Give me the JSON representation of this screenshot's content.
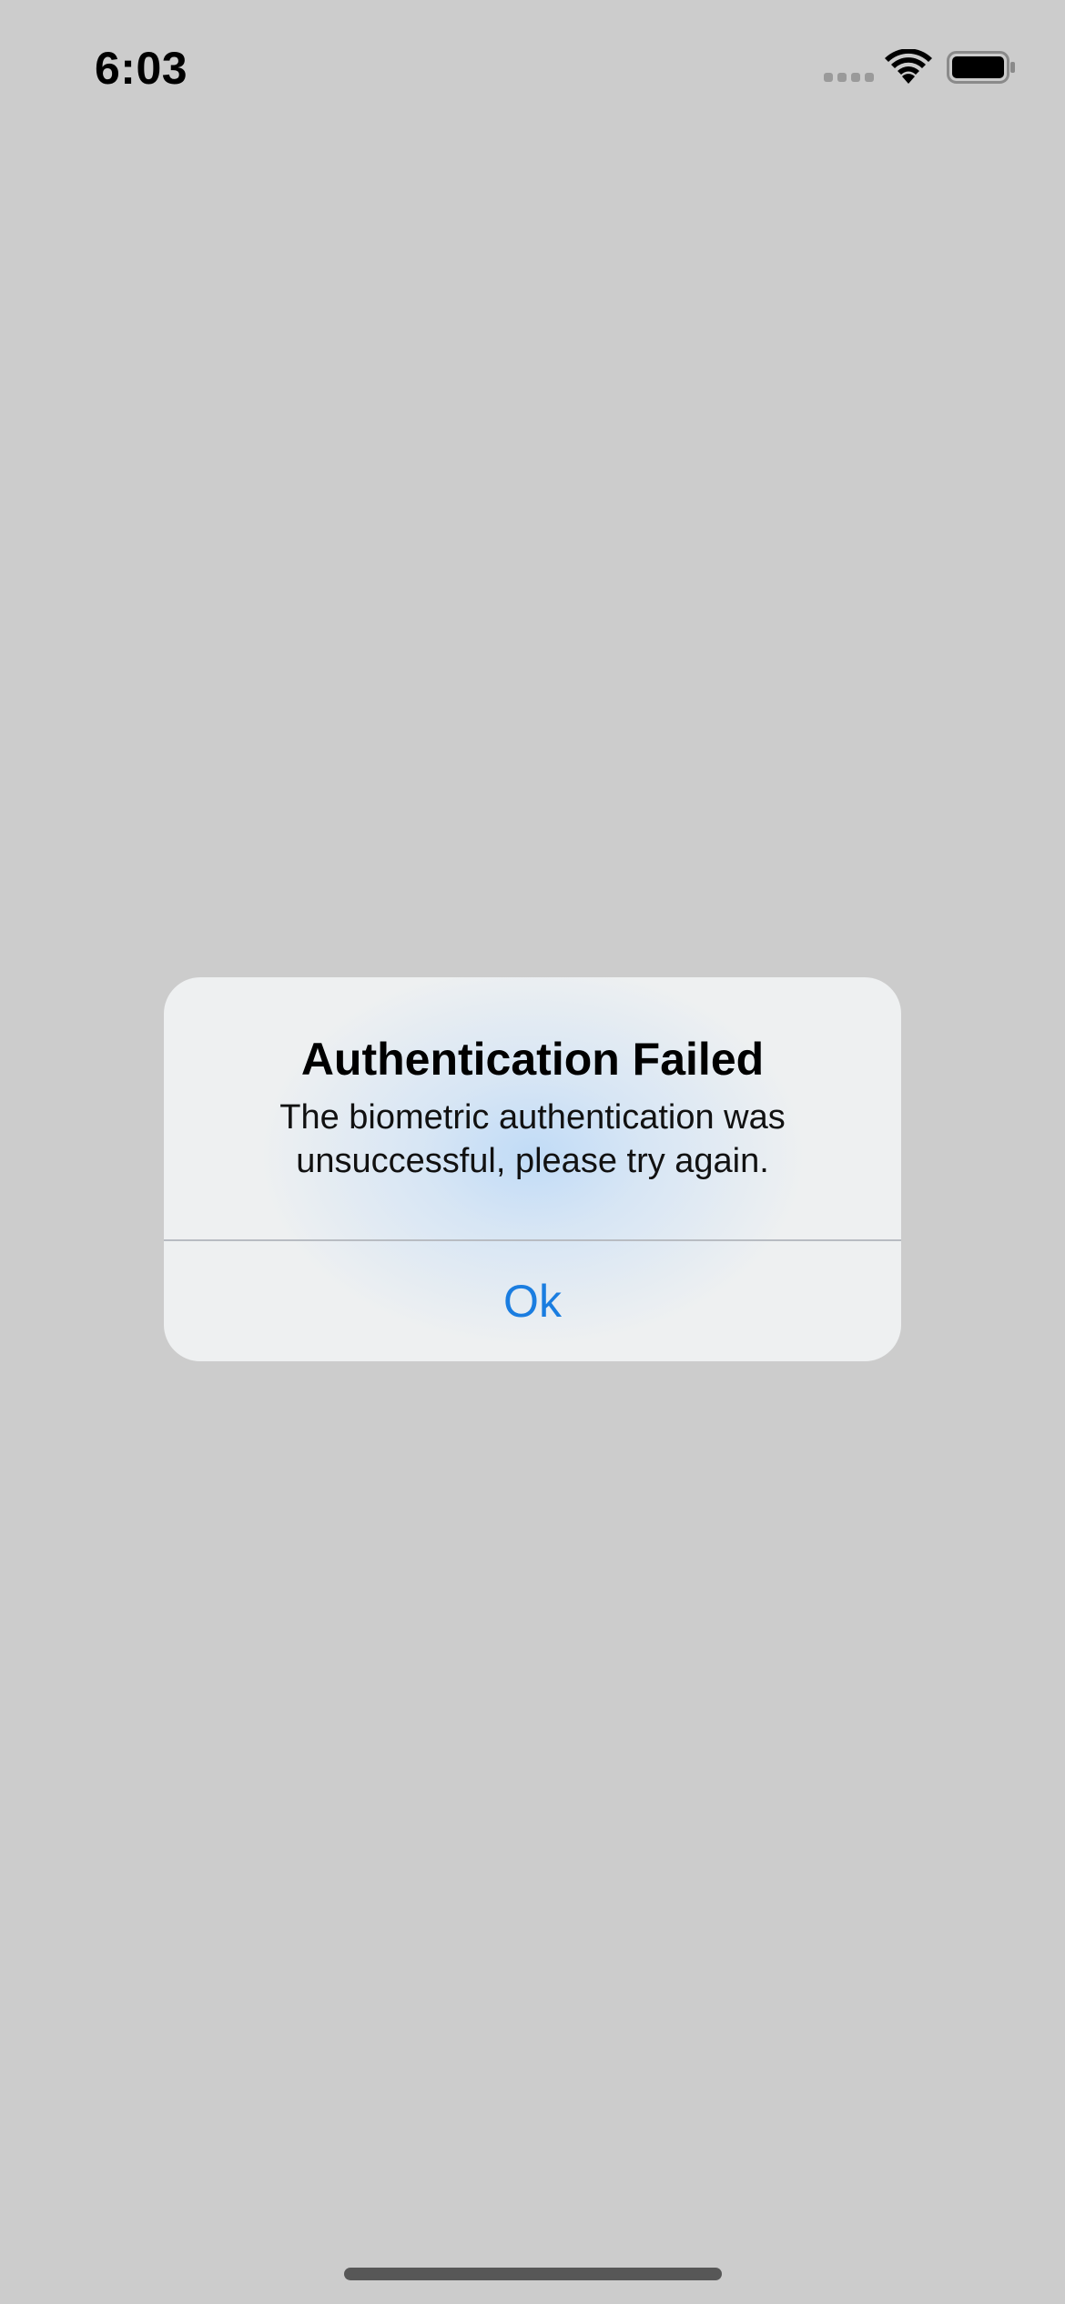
{
  "status_bar": {
    "time": "6:03",
    "signal_icon": "cellular-signal-icon",
    "wifi_icon": "wifi-icon",
    "battery_icon": "battery-icon"
  },
  "alert": {
    "title": "Authentication Failed",
    "message": "The biometric authentication was unsuccessful, please try again.",
    "button_label": "Ok",
    "accent_color": "#1a7de0"
  },
  "colors": {
    "background": "#cccccc",
    "alert_background": "#eef0f1",
    "home_indicator": "#575757"
  }
}
